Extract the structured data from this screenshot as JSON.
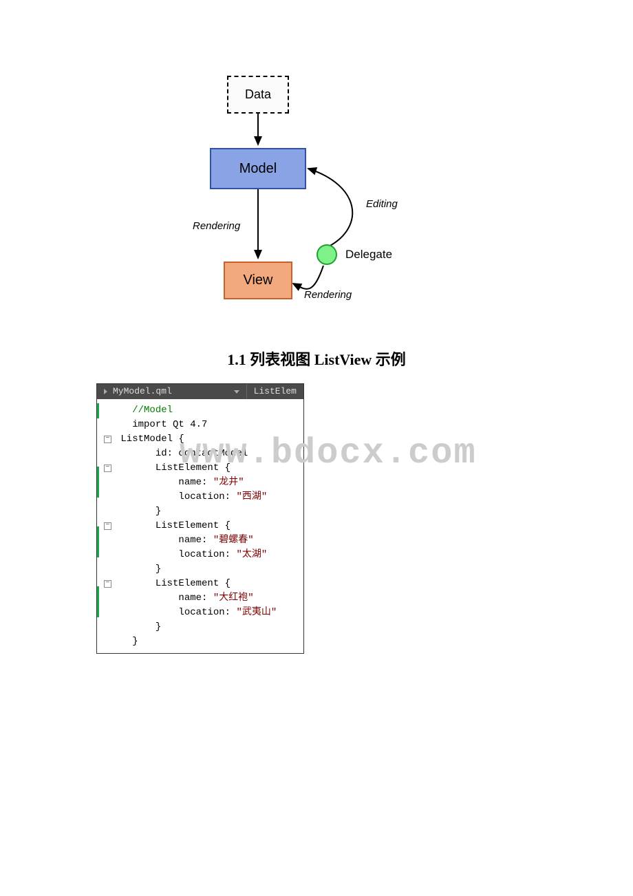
{
  "diagram": {
    "data_label": "Data",
    "model_label": "Model",
    "view_label": "View",
    "delegate_label": "Delegate",
    "editing_label": "Editing",
    "rendering_label_1": "Rendering",
    "rendering_label_2": "Rendering"
  },
  "heading": "1.1 列表视图 ListView 示例",
  "editor": {
    "tab1": "MyModel.qml",
    "tab2": "ListElem",
    "code": {
      "l1": "//Model",
      "l2": "import Qt 4.7",
      "l3": "ListModel {",
      "l4": "    id: contactModel",
      "l5": "    ListElement {",
      "l6a": "        name: ",
      "l6b": "\"龙井\"",
      "l7a": "        location: ",
      "l7b": "\"西湖\"",
      "l8": "    }",
      "l9": "    ListElement {",
      "l10a": "        name: ",
      "l10b": "\"碧螺春\"",
      "l11a": "        location: ",
      "l11b": "\"太湖\"",
      "l12": "    }",
      "l13": "    ListElement {",
      "l14a": "        name: ",
      "l14b": "\"大红袍\"",
      "l15a": "        location: ",
      "l15b": "\"武夷山\"",
      "l16": "    }",
      "l17": "}"
    }
  },
  "watermark": "www.bdocx.com"
}
